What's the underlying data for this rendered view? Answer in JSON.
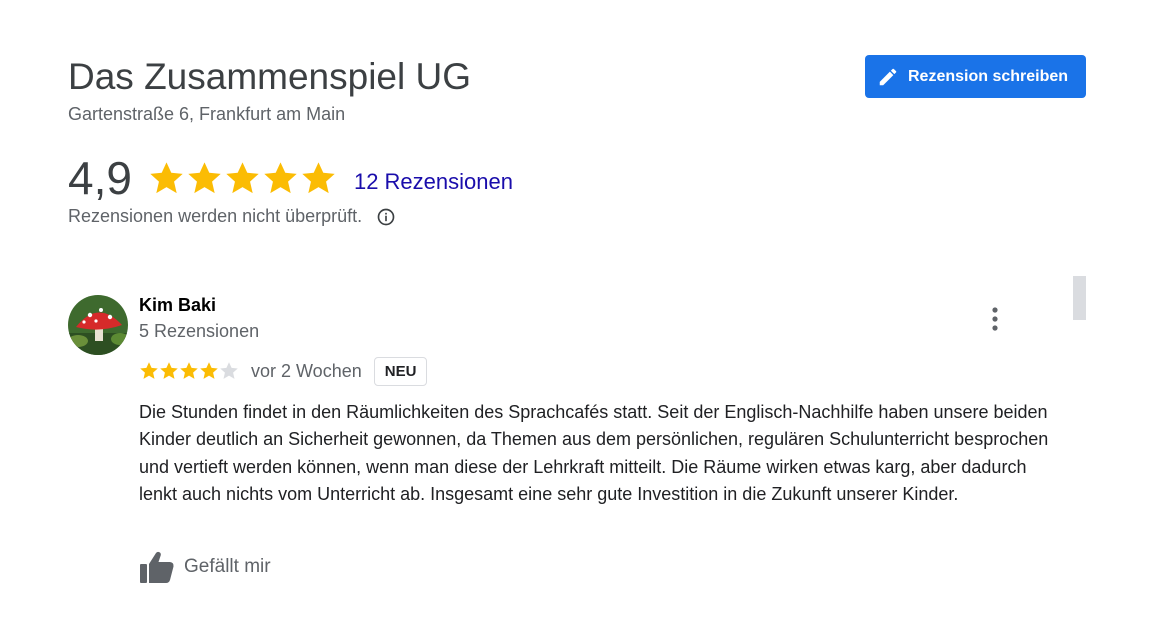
{
  "business": {
    "name": "Das Zusammenspiel UG",
    "address": "Gartenstraße 6, Frankfurt am Main"
  },
  "write_review_button": {
    "label": "Rezension schreiben",
    "icon": "pencil-icon",
    "color": "#1a73e8"
  },
  "rating": {
    "value_text": "4,9",
    "stars": 5,
    "star_color": "#fbbc04",
    "reviews_link": "12 Rezensionen",
    "unverified_note": "Rezensionen werden nicht überprüft.",
    "info_icon": "info-icon"
  },
  "review": {
    "reviewer_name": "Kim Baki",
    "reviewer_review_count": "5 Rezensionen",
    "avatar_icon": "mushroom-avatar",
    "rating_stars": 4,
    "max_stars": 5,
    "time": "vor 2 Wochen",
    "badge": "NEU",
    "text": "Die Stunden findet in den Räumlichkeiten des Sprachcafés statt. Seit der Englisch-Nachhilfe haben unsere beiden Kinder deutlich an Sicherheit gewonnen, da Themen aus dem persönlichen, regulären Schulunterricht besprochen und vertieft werden können, wenn man diese der Lehrkraft mitteilt. Die Räume wirken  etwas karg, aber dadurch lenkt auch nichts vom Unterricht ab. Insgesamt eine sehr gute Investition in die Zukunft unserer Kinder.",
    "like_label": "Gefällt mir",
    "like_icon": "thumbs-up-icon",
    "more_icon": "more-vertical-icon"
  }
}
